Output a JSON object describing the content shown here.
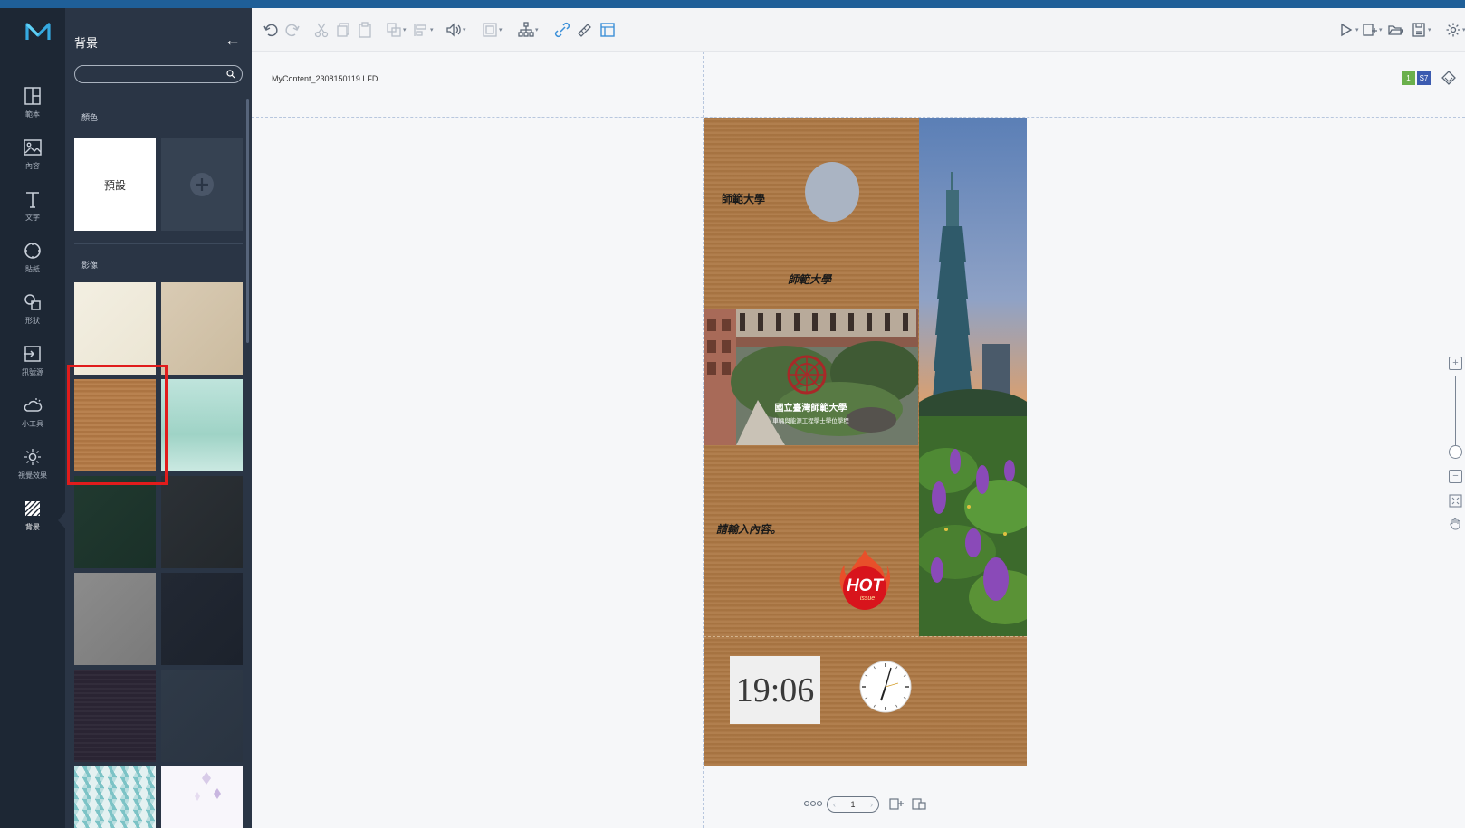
{
  "app": {
    "accent": "#1f5f98",
    "logo": "M"
  },
  "rail": {
    "items": [
      {
        "id": "template",
        "label": "範本",
        "icon": "layout-icon"
      },
      {
        "id": "content",
        "label": "內容",
        "icon": "image-icon"
      },
      {
        "id": "text",
        "label": "文字",
        "icon": "text-icon"
      },
      {
        "id": "sticker",
        "label": "貼紙",
        "icon": "sticker-icon"
      },
      {
        "id": "shape",
        "label": "形狀",
        "icon": "shape-icon"
      },
      {
        "id": "signal",
        "label": "訊號源",
        "icon": "signal-source-icon"
      },
      {
        "id": "widget",
        "label": "小工具",
        "icon": "weather-icon"
      },
      {
        "id": "effects",
        "label": "視覺效果",
        "icon": "effects-icon"
      },
      {
        "id": "background",
        "label": "背景",
        "icon": "background-icon",
        "active": true
      }
    ]
  },
  "panel": {
    "title": "背景",
    "search_placeholder": "",
    "color_section": "顏色",
    "default_swatch": "預設",
    "image_section": "影像",
    "selected_tile": "cardboard"
  },
  "toolbar": {
    "left": [
      "undo-icon",
      "redo-icon",
      "cut-icon",
      "copy-icon",
      "paste-icon",
      "arrange-icon",
      "align-icon",
      "volume-icon",
      "group-icon",
      "hierarchy-icon",
      "link-icon",
      "ruler-icon",
      "grid-icon"
    ],
    "right": [
      "play-icon",
      "add-page-icon",
      "open-folder-icon",
      "save-icon",
      "settings-icon"
    ]
  },
  "document": {
    "filename": "MyContent_2308150119.LFD",
    "badges": [
      {
        "text": "1",
        "color": "#6ab04c"
      },
      {
        "text": "S7",
        "color": "#3c5bb0"
      }
    ]
  },
  "artboard": {
    "text1": "師範大學",
    "text2": "師範大學",
    "text3": "請輸入內容。",
    "campus_title": "國立臺灣師範大學",
    "campus_subtitle": "車輛與能源工程學士學位學程",
    "digital_clock": "19:06",
    "hot_label": "HOT",
    "hot_sub": "issue"
  },
  "pager": {
    "current_page": "1"
  }
}
